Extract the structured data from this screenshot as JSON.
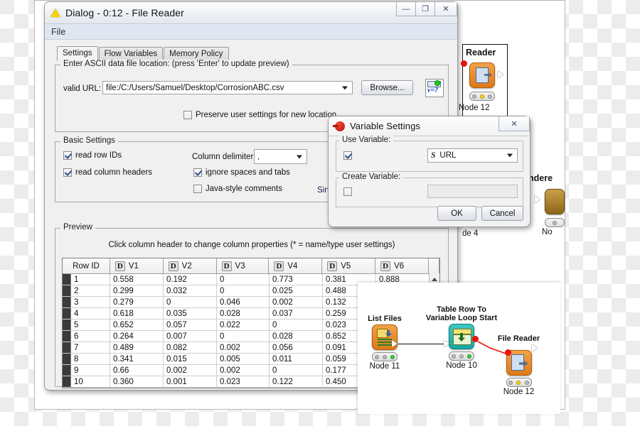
{
  "dialog": {
    "title": "Dialog - 0:12 - File Reader",
    "warning_icon": "warning-triangle-icon",
    "window_buttons": {
      "minimize": "—",
      "maximize": "❐",
      "close": "✕"
    },
    "menu": [
      "File"
    ],
    "tabs": [
      {
        "label": "Settings",
        "active": true
      },
      {
        "label": "Flow Variables",
        "active": false
      },
      {
        "label": "Memory Policy",
        "active": false
      }
    ],
    "location_group": {
      "legend": "Enter ASCII data file location: (press 'Enter' to update preview)",
      "url_label": "valid URL:",
      "url_value": "file:/C:/Users/Samuel/Desktop/CorrosionABC.csv",
      "browse_label": "Browse...",
      "flow_var_button": "flow-variable-icon",
      "flow_var_text": "v=?",
      "preserve_label": "Preserve user settings for new location",
      "preserve_checked": false
    },
    "basic_settings": {
      "legend": "Basic Settings",
      "read_row_ids": {
        "label": "read row IDs",
        "checked": true
      },
      "read_column_headers": {
        "label": "read column headers",
        "checked": true
      },
      "column_delimiter_label": "Column delimiter:",
      "column_delimiter_value": ",",
      "ignore_spaces": {
        "label": "ignore spaces and tabs",
        "checked": true
      },
      "java_comments": {
        "label": "Java-style comments",
        "checked": false
      },
      "single_line_truncated": "Sin"
    },
    "preview": {
      "legend": "Preview",
      "hint": "Click column header to change column properties (* = name/type user settings)",
      "columns": [
        "Row ID",
        "V1",
        "V2",
        "V3",
        "V4",
        "V5",
        "V6"
      ],
      "column_type_icon": "D",
      "rows": [
        {
          "id": "1",
          "cells": [
            "0.558",
            "0.192",
            "0",
            "0.773",
            "0.381",
            "0.888"
          ]
        },
        {
          "id": "2",
          "cells": [
            "0.299",
            "0.032",
            "0",
            "0.025",
            "0.488",
            ""
          ]
        },
        {
          "id": "3",
          "cells": [
            "0.279",
            "0",
            "0.046",
            "0.002",
            "0.132",
            ""
          ]
        },
        {
          "id": "4",
          "cells": [
            "0.618",
            "0.035",
            "0.028",
            "0.037",
            "0.259",
            ""
          ]
        },
        {
          "id": "5",
          "cells": [
            "0.652",
            "0.057",
            "0.022",
            "0",
            "0.023",
            ""
          ]
        },
        {
          "id": "6",
          "cells": [
            "0.264",
            "0.007",
            "0",
            "0.028",
            "0.852",
            ""
          ]
        },
        {
          "id": "7",
          "cells": [
            "0.489",
            "0.082",
            "0.002",
            "0.056",
            "0.091",
            ""
          ]
        },
        {
          "id": "8",
          "cells": [
            "0.341",
            "0.015",
            "0.005",
            "0.011",
            "0.059",
            ""
          ]
        },
        {
          "id": "9",
          "cells": [
            "0.66",
            "0.002",
            "0.002",
            "0",
            "0.177",
            ""
          ]
        },
        {
          "id": "10",
          "cells": [
            "0.360",
            "0.001",
            "0.023",
            "0.122",
            "0.450",
            ""
          ]
        }
      ],
      "scroll_up_arrow": "scroll-up-icon"
    }
  },
  "variable_dialog": {
    "title": "Variable Settings",
    "icon": "flow-variable-red-icon",
    "close_label": "✕",
    "use_variable": {
      "legend": "Use Variable:",
      "checked": true,
      "value": "URL",
      "type_icon": "S"
    },
    "create_variable": {
      "legend": "Create Variable:",
      "checked": false,
      "value": ""
    },
    "ok_label": "OK",
    "cancel_label": "Cancel"
  },
  "workflow": {
    "nodes": [
      {
        "name": "List Files",
        "id": "Node 11",
        "color": "orange",
        "status": "green",
        "icon": "list-files-icon"
      },
      {
        "name": "Table Row To\nVariable Loop Start",
        "name_line1": "Table Row To",
        "name_line2": "Variable Loop Start",
        "id": "Node 10",
        "color": "teal",
        "status": "green",
        "icon": "loop-start-icon"
      },
      {
        "name": "File Reader",
        "id": "Node 12",
        "color": "orange",
        "status": "yellow",
        "icon": "file-reader-icon"
      }
    ]
  },
  "background": {
    "file_reader_label": "Reader",
    "file_reader_node_id": "Node 12",
    "renderer_label": "ndere",
    "renderer_node_id": "No",
    "node4_id": "de 4"
  },
  "colors": {
    "accent_orange": "#dd7a18",
    "accent_teal": "#17a8a4",
    "accent_gold": "#8e6518",
    "status_green": "#35d935",
    "status_yellow": "#f5d712",
    "connection_red": "#e8140c",
    "menubar_blue": "#dfe6f2"
  }
}
